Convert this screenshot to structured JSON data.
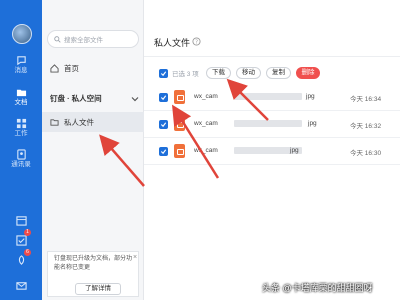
{
  "rail": {
    "items": [
      {
        "label": "消息",
        "icon": "chat-icon"
      },
      {
        "label": "文档",
        "icon": "document-icon"
      },
      {
        "label": "工作",
        "icon": "grid-icon"
      },
      {
        "label": "通讯录",
        "icon": "contacts-icon"
      }
    ],
    "badges": [
      "1",
      "6"
    ]
  },
  "nav": {
    "search_placeholder": "搜索全部文件",
    "home": "首页",
    "group": "钉盘 · 私人空间",
    "private_files": "私人文件",
    "notice_text": "钉盘现已升级为文档，部分功能名称已变更",
    "notice_close": "×",
    "notice_button": "了解详情"
  },
  "main": {
    "title": "私人文件",
    "selected_count": "已选 3 项",
    "toolbar": {
      "download": "下载",
      "move": "移动",
      "copy": "复制",
      "delete": "删除"
    },
    "files": [
      {
        "prefix": "wx_cam",
        "ext": "jpg",
        "time": "今天 16:34"
      },
      {
        "prefix": "wx_cam",
        "ext": "jpg",
        "time": "今天 16:32"
      },
      {
        "prefix": "wx_cam",
        "ext": "jpg",
        "time": "今天 16:30"
      }
    ]
  },
  "watermark": "头条 @卡塔库栗的甜甜圈呀",
  "colors": {
    "rail": "#1e6fd9",
    "accent": "#1e6fd9",
    "danger": "#f0504e",
    "arrow": "#e0443a"
  }
}
